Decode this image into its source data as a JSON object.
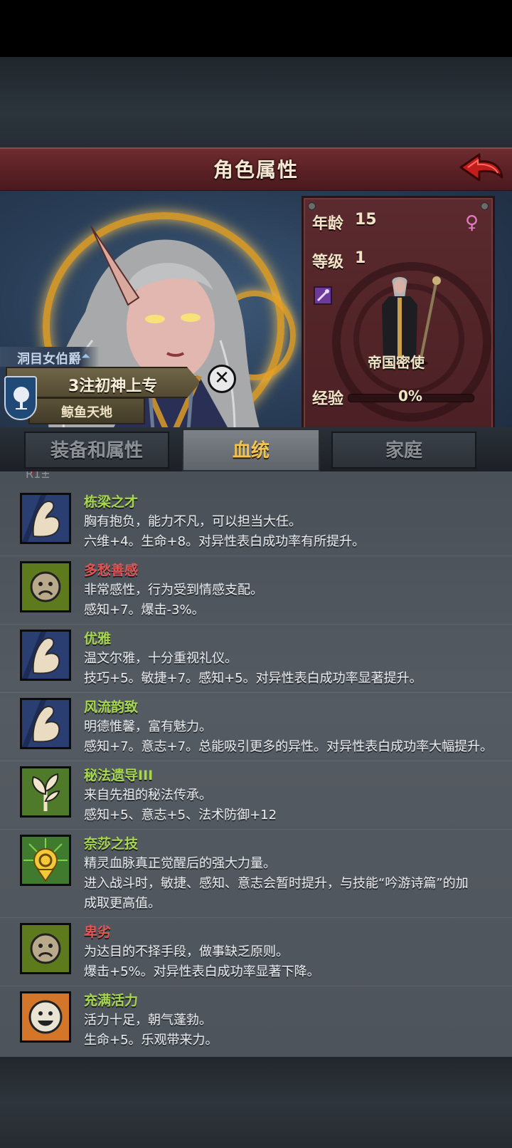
{
  "header": {
    "title": "角色属性"
  },
  "character": {
    "rank": "洞目女伯爵",
    "name": "3注初神上专",
    "land": "鲸鱼天地",
    "age_label": "年龄",
    "age_value": "15",
    "level_label": "等级",
    "level_value": "1",
    "class_name": "帝国密使",
    "xp_label": "经验",
    "xp_value": "0%",
    "xp_fraction": 0,
    "gender": "♀"
  },
  "tabs": [
    {
      "label": "装备和属性",
      "active": false
    },
    {
      "label": "血统",
      "active": true
    },
    {
      "label": "家庭",
      "active": false
    }
  ],
  "cut_text": "R1±",
  "traits": [
    {
      "name": "栋梁之才",
      "color": "green",
      "icon": "flexed-arm-icon",
      "lines": [
        "胸有抱负，能力不凡，可以担当大任。",
        "六维+4。生命+8。对异性表白成功率有所提升。"
      ]
    },
    {
      "name": "多愁善感",
      "color": "red",
      "icon": "sad-face-icon",
      "lines": [
        "非常感性，行为受到情感支配。",
        "感知+7。爆击-3%。"
      ]
    },
    {
      "name": "优雅",
      "color": "green",
      "icon": "flexed-arm-icon",
      "lines": [
        "温文尔雅，十分重视礼仪。",
        "技巧+5。敏捷+7。感知+5。对异性表白成功率显著提升。"
      ]
    },
    {
      "name": "风流韵致",
      "color": "green",
      "icon": "flexed-arm-icon",
      "lines": [
        "明德惟馨，富有魅力。",
        "感知+7。意志+7。总能吸引更多的异性。对异性表白成功率大幅提升。"
      ]
    },
    {
      "name": "秘法遗导III",
      "color": "green",
      "icon": "sprout-icon",
      "lines": [
        "来自先祖的秘法传承。",
        "感知+5、意志+5、法术防御+12"
      ]
    },
    {
      "name": "奈莎之技",
      "color": "green",
      "icon": "golden-emblem-icon",
      "lines": [
        "精灵血脉真正觉醒后的强大力量。",
        "进入战斗时，敏捷、感知、意志会暂时提升，与技能“吟游诗篇”的加",
        "成取更高值。"
      ]
    },
    {
      "name": "卑劣",
      "color": "red",
      "icon": "sad-face-icon",
      "lines": [
        "为达目的不择手段，做事缺乏原则。",
        "爆击+5%。对异性表白成功率显著下降。"
      ]
    },
    {
      "name": "充满活力",
      "color": "green",
      "icon": "happy-face-icon",
      "lines": [
        "活力十足，朝气蓬勃。",
        "生命+5。乐观带来力。"
      ]
    }
  ]
}
